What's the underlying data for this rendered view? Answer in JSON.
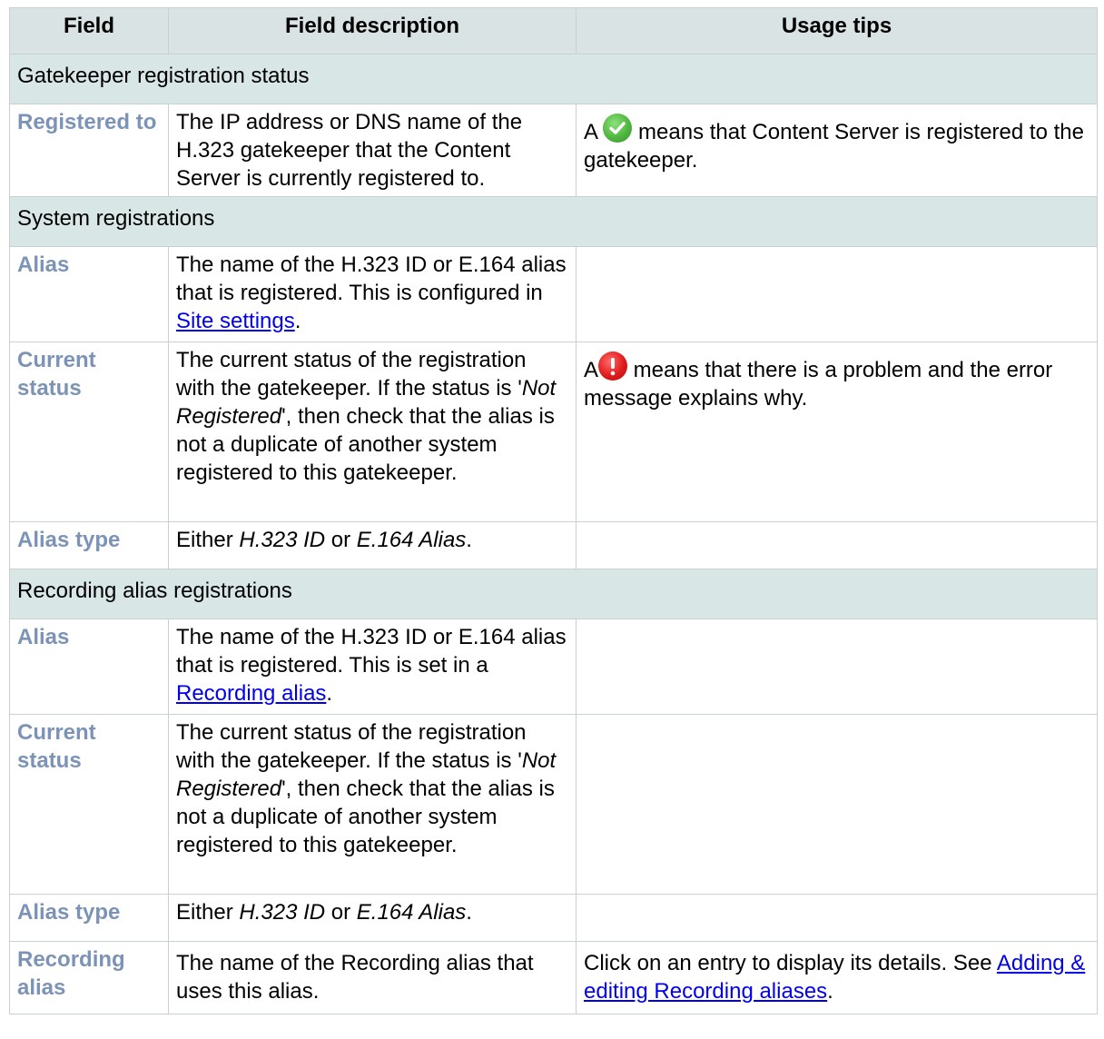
{
  "headers": {
    "field": "Field",
    "description": "Field description",
    "tips": "Usage tips"
  },
  "sections": {
    "gatekeeper": "Gatekeeper registration status",
    "system": "System registrations",
    "recording": "Recording alias registrations"
  },
  "rows": {
    "registered_to": {
      "field": "Registered to",
      "desc": "The IP address or DNS name of the H.323 gatekeeper that the Content Server is currently registered to.",
      "tip_prefix": "A",
      "tip_icon": "check-circle-icon",
      "tip_text": " means that Content Server is registered to the gatekeeper."
    },
    "sys_alias": {
      "field": "Alias",
      "desc_pre": "The name of the H.323 ID or E.164 alias that is registered. This is configured in ",
      "desc_link": "Site settings",
      "desc_post": "."
    },
    "sys_status": {
      "field": "Current status",
      "desc_pre": "The current status of the registration with the gatekeeper. If the status is '",
      "desc_em": "Not Registered",
      "desc_post": "', then check that the alias is not a duplicate of another system registered to this gatekeeper.",
      "tip_prefix": "A",
      "tip_icon": "error-exclamation-icon",
      "tip_text": " means that there is a problem and the error message explains why."
    },
    "sys_type": {
      "field": "Alias type",
      "desc_pre": "Either ",
      "desc_em1": "H.323 ID",
      "desc_mid": " or ",
      "desc_em2": "E.164 Alias",
      "desc_post": "."
    },
    "rec_alias": {
      "field": "Alias",
      "desc_pre": "The name of the H.323 ID or E.164 alias that is registered. This is set in a ",
      "desc_link": "Recording alias",
      "desc_post": "."
    },
    "rec_status": {
      "field": "Current status",
      "desc_pre": "The current status of the registration with the gatekeeper. If the status is '",
      "desc_em": "Not Registered",
      "desc_post": "', then check that the alias is not a duplicate of another system registered to this gatekeeper."
    },
    "rec_type": {
      "field": "Alias type",
      "desc_pre": "Either ",
      "desc_em1": "H.323 ID",
      "desc_mid": " or ",
      "desc_em2": "E.164 Alias",
      "desc_post": "."
    },
    "rec_recording_alias": {
      "field": "Recording alias",
      "desc": "The name of the Recording alias that uses this alias.",
      "tip_pre": "Click on an entry to display its details. See ",
      "tip_link": "Adding & editing Recording aliases",
      "tip_post": "."
    }
  },
  "colors": {
    "header_bg": "#d9e3e3",
    "section_bg": "#d9e6e6",
    "field_text": "#7c93b8",
    "link": "#0000ee"
  }
}
